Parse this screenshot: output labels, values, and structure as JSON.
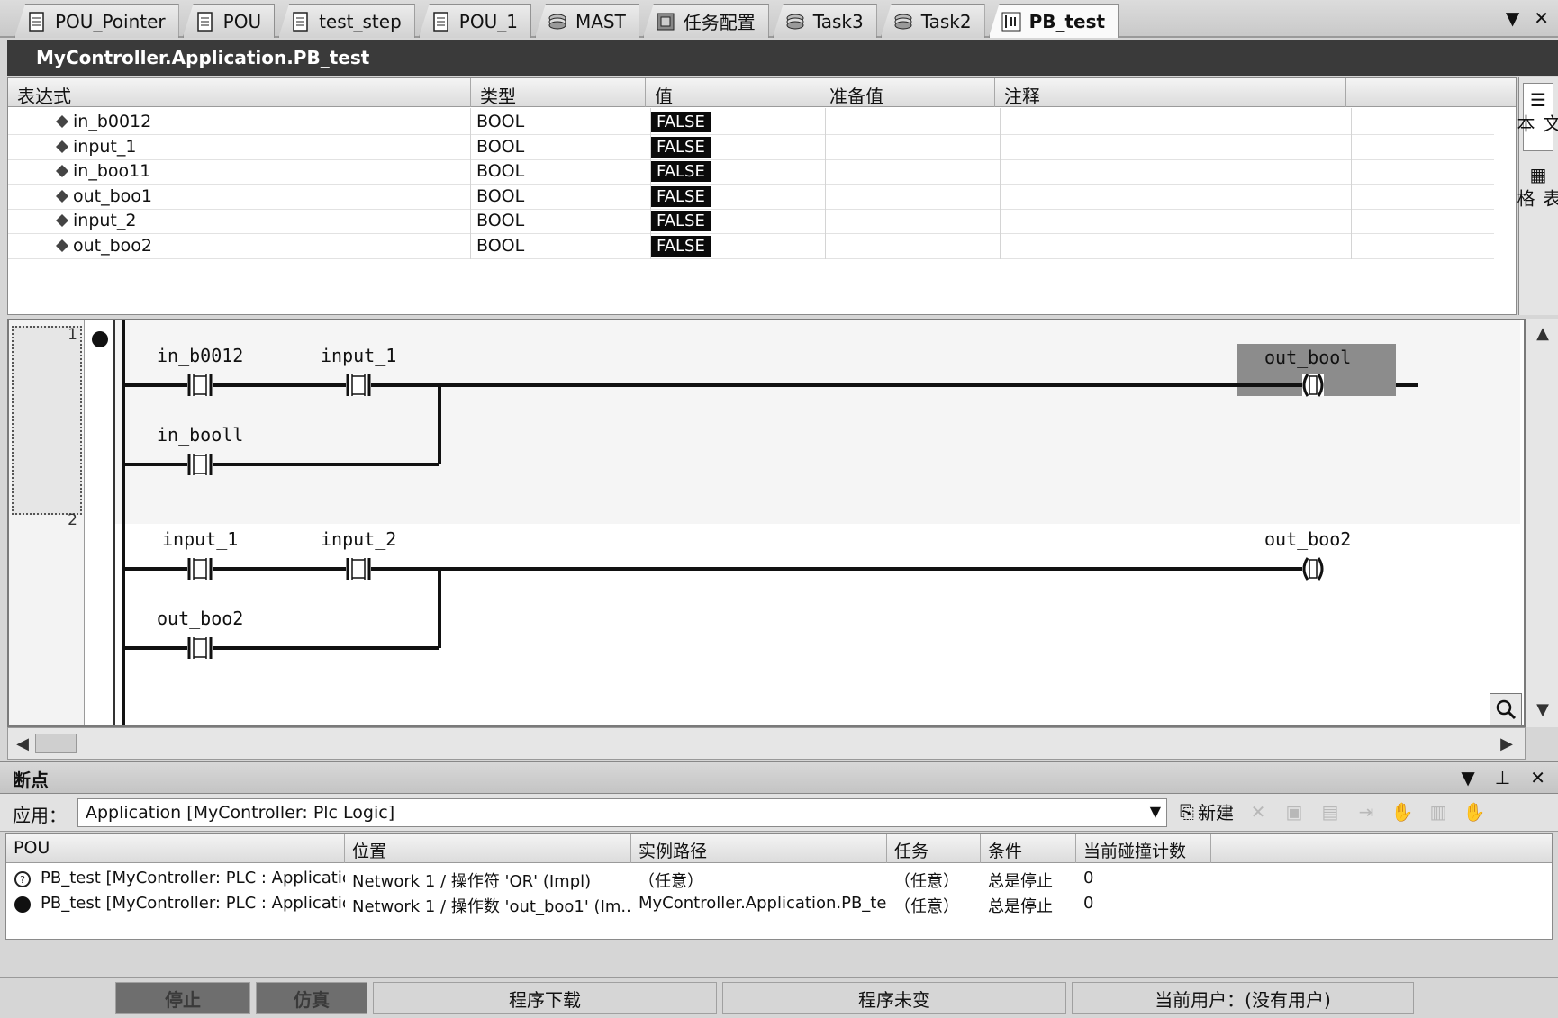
{
  "tabs": [
    {
      "label": "POU_Pointer",
      "icon": "document-icon",
      "active": false
    },
    {
      "label": "POU",
      "icon": "document-icon",
      "active": false
    },
    {
      "label": "test_step",
      "icon": "document-icon",
      "active": false
    },
    {
      "label": "POU_1",
      "icon": "document-icon",
      "active": false
    },
    {
      "label": "MAST",
      "icon": "task-icon",
      "active": false
    },
    {
      "label": "任务配置",
      "icon": "task-config-icon",
      "active": false
    },
    {
      "label": "Task3",
      "icon": "task-icon",
      "active": false
    },
    {
      "label": "Task2",
      "icon": "task-icon",
      "active": false
    },
    {
      "label": "PB_test",
      "icon": "ladder-icon",
      "active": true
    }
  ],
  "watch": {
    "path": "MyController.Application.PB_test",
    "columns": [
      "表达式",
      "类型",
      "值",
      "准备值",
      "注释"
    ],
    "rows": [
      {
        "expr": "in_b0012",
        "type": "BOOL",
        "value": "FALSE",
        "prepared": "",
        "comment": ""
      },
      {
        "expr": "input_1",
        "type": "BOOL",
        "value": "FALSE",
        "prepared": "",
        "comment": ""
      },
      {
        "expr": "in_boo11",
        "type": "BOOL",
        "value": "FALSE",
        "prepared": "",
        "comment": ""
      },
      {
        "expr": "out_boo1",
        "type": "BOOL",
        "value": "FALSE",
        "prepared": "",
        "comment": ""
      },
      {
        "expr": "input_2",
        "type": "BOOL",
        "value": "FALSE",
        "prepared": "",
        "comment": ""
      },
      {
        "expr": "out_boo2",
        "type": "BOOL",
        "value": "FALSE",
        "prepared": "",
        "comment": ""
      }
    ],
    "side_tabs": [
      "文本",
      "表格"
    ]
  },
  "ladder": {
    "networks": [
      {
        "number": "1",
        "contacts": [
          "in_b0012",
          "input_1",
          "in_booll"
        ],
        "coil": "out_bool"
      },
      {
        "number": "2",
        "contacts": [
          "input_1",
          "input_2",
          "out_boo2"
        ],
        "coil": "out_boo2"
      }
    ]
  },
  "breakpoints": {
    "title": "断点",
    "app_label": "应用：",
    "app_value": "Application [MyController: Plc Logic]",
    "new_label": "新建",
    "columns": [
      "POU",
      "位置",
      "实例路径",
      "任务",
      "条件",
      "当前碰撞计数"
    ],
    "rows": [
      {
        "icon": "breakpoint-disabled-icon",
        "pou": "PB_test [MyController: PLC : Application]",
        "location": "Network 1 / 操作符 'OR' (Impl)",
        "instance": "（任意）",
        "task": "（任意）",
        "condition": "总是停止",
        "hits": "0"
      },
      {
        "icon": "breakpoint-enabled-icon",
        "pou": "PB_test [MyController: PLC : Application]",
        "location": "Network 1 / 操作数 'out_boo1' (Im...",
        "instance": "MyController.Application.PB_test",
        "task": "（任意）",
        "condition": "总是停止",
        "hits": "0"
      }
    ]
  },
  "status": {
    "stop": "停止",
    "sim": "仿真",
    "download": "程序下载",
    "unchanged": "程序未变",
    "user": "当前用户：(没有用户)"
  }
}
